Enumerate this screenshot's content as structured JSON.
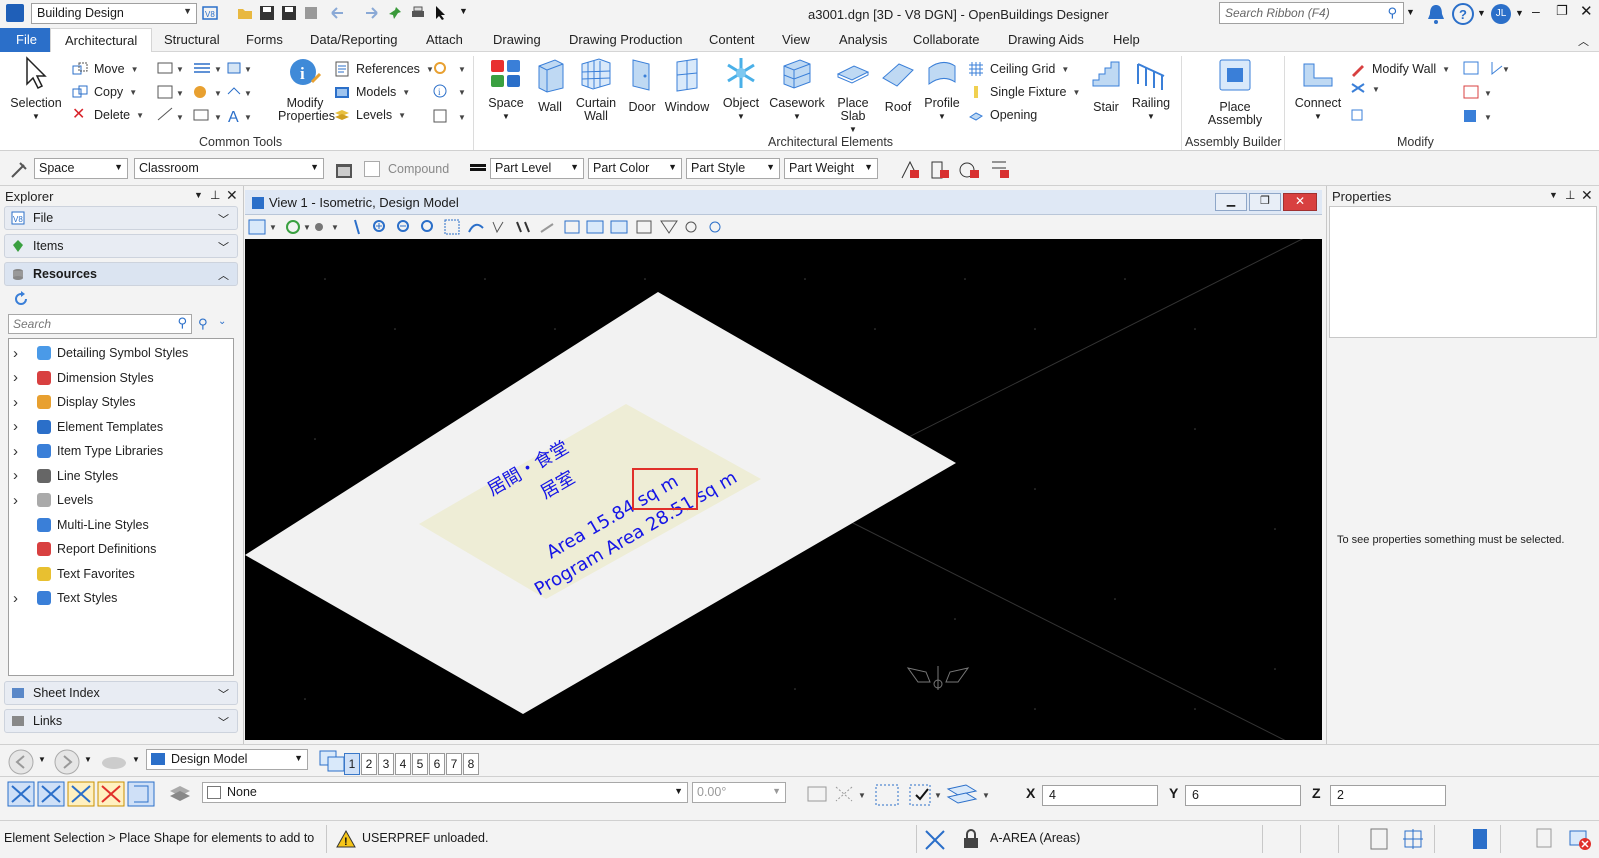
{
  "titlebar": {
    "workflow": "Building Design",
    "window_title": "a3001.dgn [3D - V8 DGN] - OpenBuildings Designer",
    "search_placeholder": "Search Ribbon (F4)",
    "user_initials": "JL"
  },
  "tabs": [
    "File",
    "Architectural",
    "Structural",
    "Forms",
    "Data/Reporting",
    "Attach",
    "Drawing",
    "Drawing Production",
    "Content",
    "View",
    "Analysis",
    "Collaborate",
    "Drawing Aids",
    "Help"
  ],
  "active_tab": "Architectural",
  "ribbon": {
    "common_tools": {
      "label": "Common Tools",
      "selection": "Selection",
      "move": "Move",
      "copy": "Copy",
      "delete": "Delete",
      "modify_properties": "Modify Properties",
      "references": "References",
      "models": "Models",
      "levels": "Levels"
    },
    "arch_elements": {
      "label": "Architectural Elements",
      "space": "Space",
      "wall": "Wall",
      "curtain_wall": "Curtain Wall",
      "door": "Door",
      "window": "Window",
      "object": "Object",
      "casework": "Casework",
      "place_slab": "Place Slab",
      "roof": "Roof",
      "profile": "Profile",
      "ceiling_grid": "Ceiling Grid",
      "single_fixture": "Single Fixture",
      "opening": "Opening",
      "stair": "Stair",
      "railing": "Railing"
    },
    "assembly_builder": {
      "label": "Assembly Builder",
      "place_assembly": "Place Assembly"
    },
    "modify": {
      "label": "Modify",
      "connect": "Connect",
      "modify_wall": "Modify Wall"
    }
  },
  "attrbar": {
    "family": "Space",
    "part": "Classroom",
    "compound": "Compound",
    "level": "Part Level",
    "color": "Part Color",
    "style": "Part Style",
    "weight": "Part Weight"
  },
  "explorer": {
    "title": "Explorer",
    "sections": {
      "file": "File",
      "items": "Items",
      "resources": "Resources",
      "sheet_index": "Sheet Index",
      "links": "Links"
    },
    "search_placeholder": "Search",
    "tree": [
      {
        "label": "Detailing Symbol Styles",
        "expandable": true
      },
      {
        "label": "Dimension Styles",
        "expandable": true
      },
      {
        "label": "Display Styles",
        "expandable": true
      },
      {
        "label": "Element Templates",
        "expandable": true
      },
      {
        "label": "Item Type Libraries",
        "expandable": true
      },
      {
        "label": "Line Styles",
        "expandable": true
      },
      {
        "label": "Levels",
        "expandable": true
      },
      {
        "label": "Multi-Line Styles",
        "expandable": false
      },
      {
        "label": "Report Definitions",
        "expandable": false
      },
      {
        "label": "Text Favorites",
        "expandable": false
      },
      {
        "label": "Text Styles",
        "expandable": true
      }
    ]
  },
  "view": {
    "title": "View 1 - Isometric, Design Model",
    "label_line1": "居間・食堂",
    "label_line2": "居室",
    "area_text": "Area 15.84 sq m",
    "program_area_text": "Program Area 28.51 sq m"
  },
  "properties": {
    "title": "Properties",
    "empty_message": "To see properties something must be selected."
  },
  "viewbar": {
    "model": "Design Model",
    "view_numbers": [
      "1",
      "2",
      "3",
      "4",
      "5",
      "6",
      "7",
      "8"
    ],
    "active_view": "1"
  },
  "acsbar": {
    "snap_mode": "None",
    "angle": "0.00°",
    "x_label": "X",
    "x_value": "4",
    "y_label": "Y",
    "y_value": "6",
    "z_label": "Z",
    "z_value": "2"
  },
  "statusbar": {
    "prompt": "Element Selection > Place Shape for elements to add to",
    "message": "USERPREF unloaded.",
    "level": "A-AREA (Areas)"
  },
  "colors": {
    "accent": "#2b6fc9",
    "view_bg": "#000000",
    "slab": "#f2f2f2",
    "area_fill": "#eeedd6",
    "area_text": "#1515e6",
    "highlight": "#e0302a"
  }
}
